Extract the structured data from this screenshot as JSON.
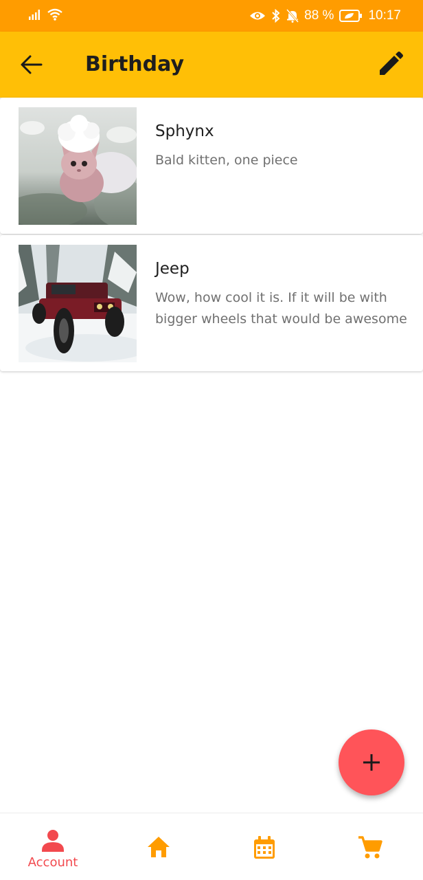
{
  "status_bar": {
    "battery": "88 %",
    "time": "10:17"
  },
  "app_bar": {
    "title": "Birthday",
    "back_icon": "arrow-left-icon",
    "edit_icon": "pencil-icon"
  },
  "items": [
    {
      "title": "Sphynx",
      "description": "Bald kitten, one piece",
      "image": "sphynx-kitten-photo"
    },
    {
      "title": "Jeep",
      "description": "Wow, how cool it is. If it will be with bigger wheels that would be awesome",
      "image": "jeep-in-snow-photo"
    }
  ],
  "fab": {
    "icon": "plus-icon"
  },
  "bottom_nav": {
    "items": [
      {
        "label": "Account",
        "icon": "person-icon",
        "active": true
      },
      {
        "label": "",
        "icon": "home-icon",
        "active": false
      },
      {
        "label": "",
        "icon": "calendar-icon",
        "active": false
      },
      {
        "label": "",
        "icon": "cart-icon",
        "active": false
      }
    ]
  },
  "colors": {
    "status_bar": "#ff9c00",
    "app_bar": "#ffbf06",
    "accent_red": "#ff5459",
    "nav_active": "#f2494e",
    "nav_inactive": "#ff9c00"
  }
}
